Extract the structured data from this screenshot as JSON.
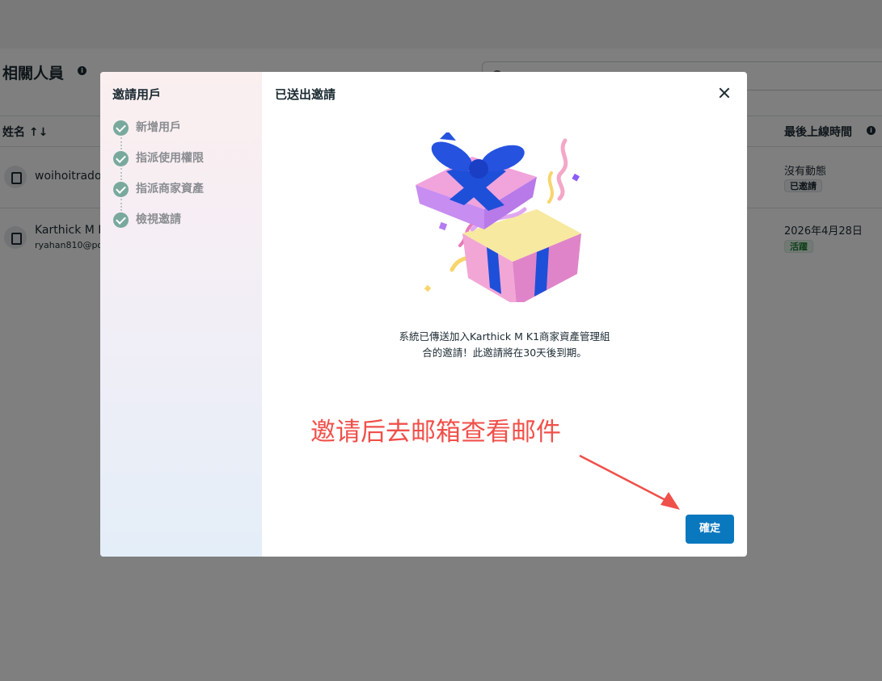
{
  "page": {
    "title": "相關人員",
    "columns": {
      "name": "姓名 ↑↓",
      "last_login": "最後上線時間"
    },
    "rows": [
      {
        "name": "woihoitrado",
        "email": "",
        "status": "沒有動態",
        "badge": "已邀請"
      },
      {
        "name": "Karthick M K",
        "email": "ryahan810@po",
        "status": "2026年4月28日",
        "badge": "活躍"
      }
    ]
  },
  "modal": {
    "side_title": "邀請用戶",
    "steps": [
      "新增用戶",
      "指派使用權限",
      "指派商家資產",
      "檢視邀請"
    ],
    "title": "已送出邀請",
    "message_line1": "系統已傳送加入Karthick M K1商家資產管理組",
    "message_line2": "合的邀請！此邀請將在30天後到期。",
    "confirm_label": "確定"
  },
  "annotation": {
    "text": "邀请后去邮箱查看邮件",
    "color": "#f0504a"
  },
  "colors": {
    "accent": "#0a78be",
    "step_check": "#79a99d"
  }
}
